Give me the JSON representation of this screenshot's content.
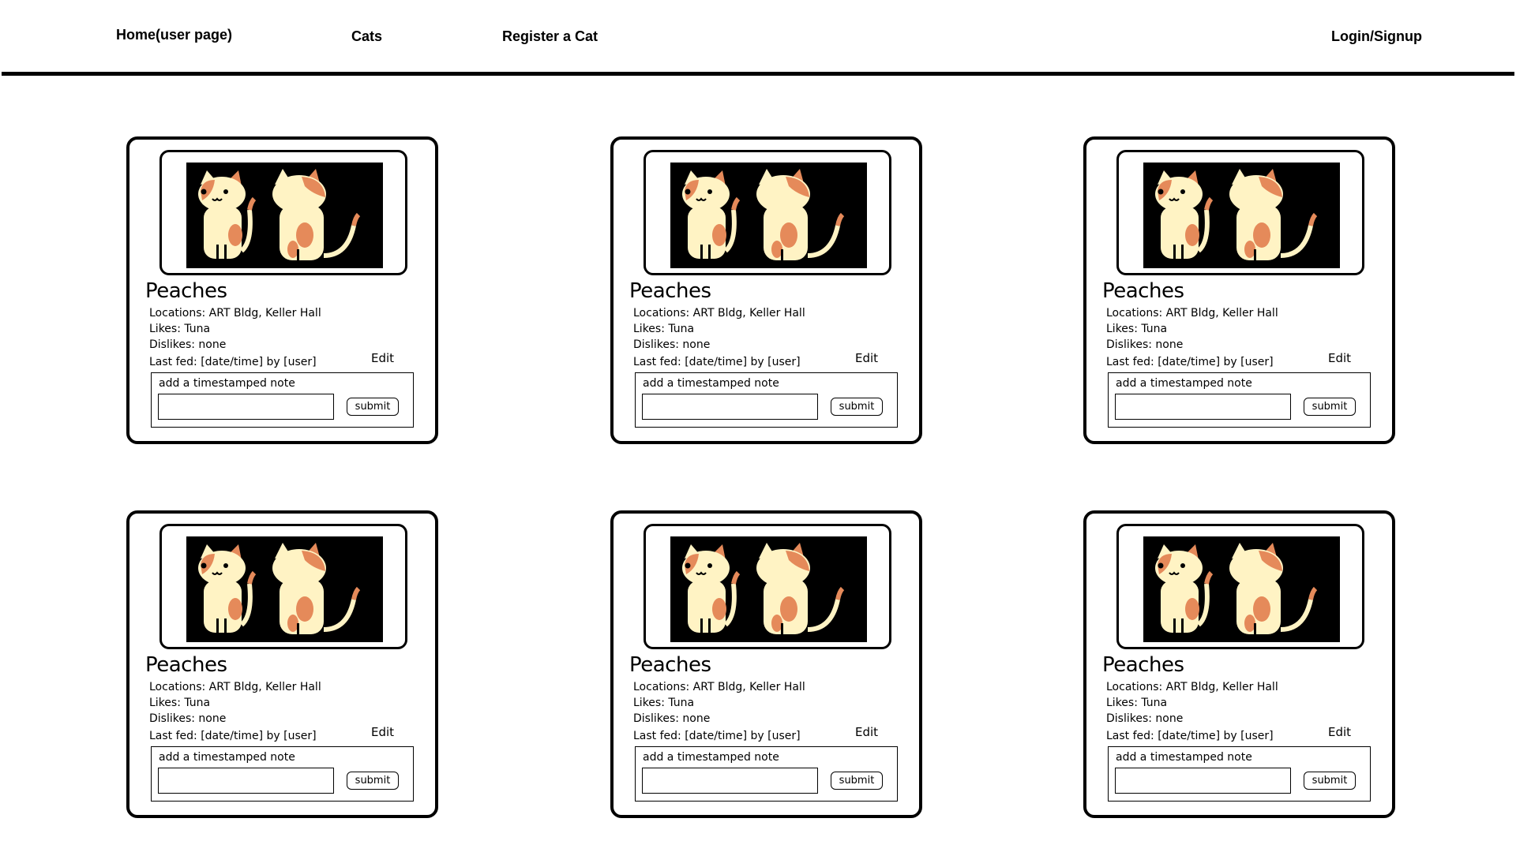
{
  "nav": {
    "home": "Home(user page)",
    "cats": "Cats",
    "register": "Register a Cat",
    "login": "Login/Signup"
  },
  "colors": {
    "cat_body": "#fff3c4",
    "cat_patch": "#e58a5a",
    "photo_bg": "#000000"
  },
  "cards": [
    {
      "name": "Peaches",
      "locations": "Locations: ART Bldg, Keller Hall",
      "likes": "Likes: Tuna",
      "dislikes": "Dislikes: none",
      "last_fed": "Last fed: [date/time] by [user]",
      "edit": "Edit",
      "note_label": "add a timestamped note",
      "note_value": "",
      "submit": "submit"
    },
    {
      "name": "Peaches",
      "locations": "Locations: ART Bldg, Keller Hall",
      "likes": "Likes: Tuna",
      "dislikes": "Dislikes: none",
      "last_fed": "Last fed: [date/time] by [user]",
      "edit": "Edit",
      "note_label": "add a timestamped note",
      "note_value": "",
      "submit": "submit"
    },
    {
      "name": "Peaches",
      "locations": "Locations: ART Bldg, Keller Hall",
      "likes": "Likes: Tuna",
      "dislikes": "Dislikes: none",
      "last_fed": "Last fed: [date/time] by [user]",
      "edit": "Edit",
      "note_label": "add a timestamped note",
      "note_value": "",
      "submit": "submit"
    },
    {
      "name": "Peaches",
      "locations": "Locations: ART Bldg, Keller Hall",
      "likes": "Likes: Tuna",
      "dislikes": "Dislikes: none",
      "last_fed": "Last fed: [date/time] by [user]",
      "edit": "Edit",
      "note_label": "add a timestamped note",
      "note_value": "",
      "submit": "submit"
    },
    {
      "name": "Peaches",
      "locations": "Locations: ART Bldg, Keller Hall",
      "likes": "Likes: Tuna",
      "dislikes": "Dislikes: none",
      "last_fed": "Last fed: [date/time] by [user]",
      "edit": "Edit",
      "note_label": "add a timestamped note",
      "note_value": "",
      "submit": "submit"
    },
    {
      "name": "Peaches",
      "locations": "Locations: ART Bldg, Keller Hall",
      "likes": "Likes: Tuna",
      "dislikes": "Dislikes: none",
      "last_fed": "Last fed: [date/time] by [user]",
      "edit": "Edit",
      "note_label": "add a timestamped note",
      "note_value": "",
      "submit": "submit"
    }
  ]
}
